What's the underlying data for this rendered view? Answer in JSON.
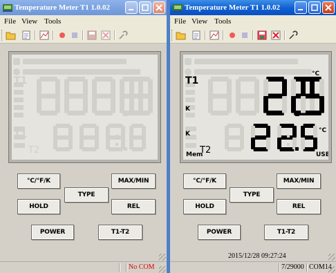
{
  "colors": {
    "lcd_bg": "#e6e4df",
    "segment_off": "#d2d0ca",
    "segment_on": "#000000",
    "status_no_com": "#e00000"
  },
  "windows": [
    {
      "title": "Temperature Meter T1 1.0.02",
      "menu": [
        "File",
        "View",
        "Tools"
      ],
      "lcd": {
        "active": false
      },
      "buttons": {
        "unit": "°C/°F/K",
        "type": "TYPE",
        "maxmin": "MAX/MIN",
        "hold": "HOLD",
        "rel": "REL",
        "power": "POWER",
        "t1t2": "T1-T2"
      },
      "status": {
        "timestamp": "",
        "connection": "No COM"
      }
    },
    {
      "title": "Temperature Meter T1 1.0.02",
      "menu": [
        "File",
        "View",
        "Tools"
      ],
      "lcd": {
        "active": true,
        "main_value": "22.5",
        "main_unit": "°C",
        "main_channel": "T1",
        "main_type": "K",
        "sub_value": "22.5",
        "sub_unit": "°C",
        "sub_channel": "T2",
        "sub_type": "K",
        "mem_label": "Mem",
        "usb_label": "USB"
      },
      "buttons": {
        "unit": "°C/°F/K",
        "type": "TYPE",
        "maxmin": "MAX/MIN",
        "hold": "HOLD",
        "rel": "REL",
        "power": "POWER",
        "t1t2": "T1-T2"
      },
      "status": {
        "timestamp": "2015/12/28 09:27:24",
        "record": "7/29000",
        "port": "COM14"
      }
    }
  ],
  "toolbar_icons": [
    "open-folder-icon",
    "document-icon",
    "chart-icon",
    "record-icon",
    "stop-icon",
    "save-icon",
    "clear-chart-icon",
    "connect-icon"
  ]
}
